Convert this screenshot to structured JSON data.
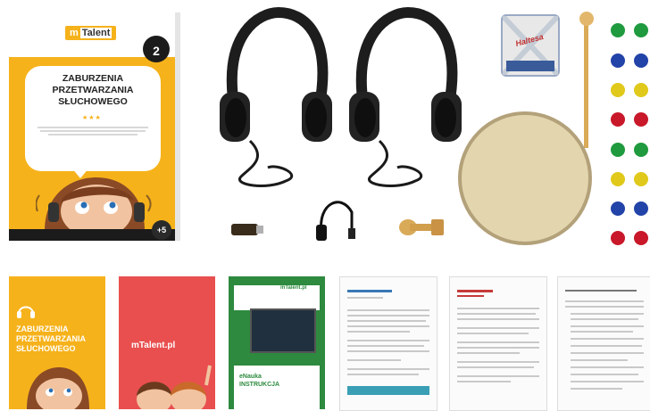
{
  "box": {
    "brand_prefix": "m",
    "brand_name": "Talent",
    "age": "2",
    "title_line1": "ZABURZENIA",
    "title_line2": "PRZETWARZANIA",
    "title_line3": "SŁUCHOWEGO",
    "plus": "+5"
  },
  "lid": {
    "logo": "Haltesa"
  },
  "books": {
    "b1_title_line1": "ZABURZENIA",
    "b1_title_line2": "PRZETWARZANIA",
    "b1_title_line3": "SŁUCHOWEGO",
    "b2_title": "mTalent.pl",
    "b3_logo": "mTalent.pl",
    "b3_title_line1": "eNauka",
    "b3_title_line2": "INSTRUKCJA"
  },
  "colors": {
    "brand_yellow": "#f6b21b",
    "brand_red": "#e94f4f",
    "brand_green": "#2d8a3e",
    "dot_colors": [
      "#1f9a3e",
      "#2243a8",
      "#e0c91a",
      "#c8182a",
      "#1f9a3e",
      "#e0c91a",
      "#2243a8",
      "#c8182a"
    ]
  }
}
